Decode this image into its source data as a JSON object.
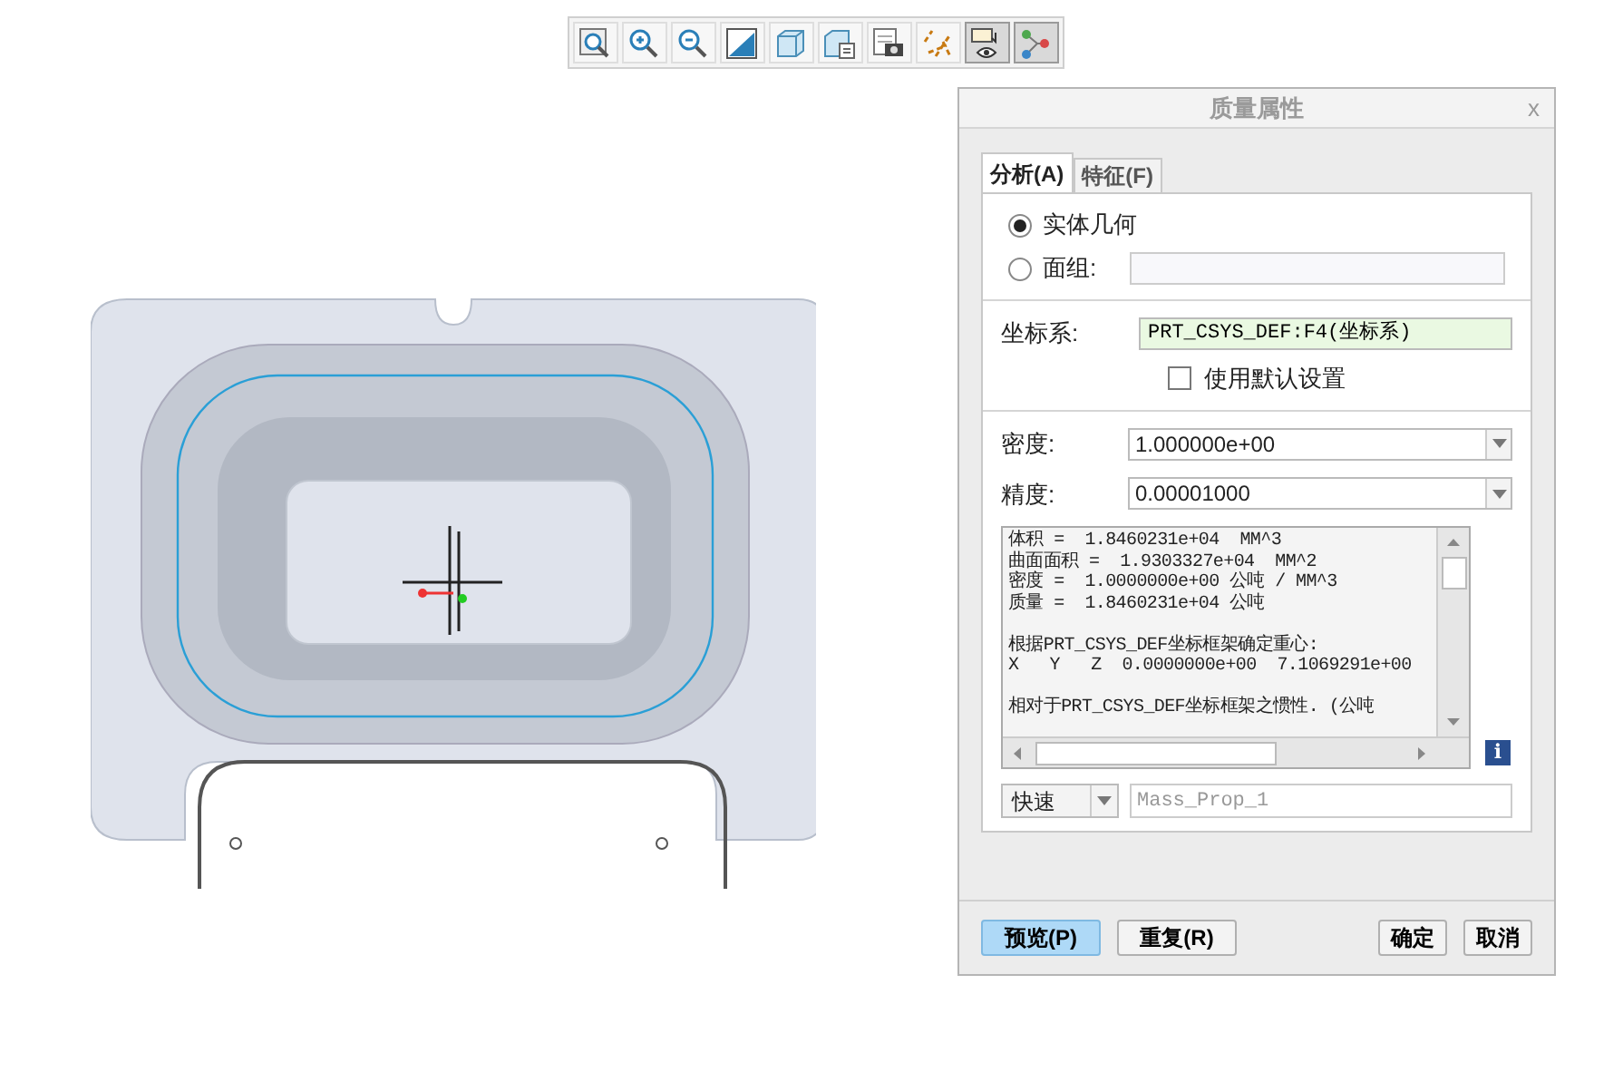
{
  "toolbar": [
    {
      "kind": "zoom-fit",
      "selected": false
    },
    {
      "kind": "zoom-in",
      "selected": false
    },
    {
      "kind": "zoom-out",
      "selected": false
    },
    {
      "kind": "repaint",
      "selected": false
    },
    {
      "kind": "view",
      "selected": false
    },
    {
      "kind": "views",
      "selected": false
    },
    {
      "kind": "camera",
      "selected": false
    },
    {
      "kind": "datum",
      "selected": false
    },
    {
      "kind": "display",
      "selected": true
    },
    {
      "kind": "nodes",
      "selected": true
    }
  ],
  "dialog": {
    "title": "质量属性",
    "close": "x",
    "tabs": [
      {
        "label": "分析(A)",
        "selected": true
      },
      {
        "label": "特征(F)",
        "selected": false
      }
    ],
    "radios": [
      {
        "label": "实体几何",
        "selected": true
      },
      {
        "label": "面组:",
        "selected": false,
        "field": true
      }
    ],
    "csys": {
      "label": "坐标系:",
      "value": "PRT_CSYS_DEF:F4(坐标系)"
    },
    "default_settings": {
      "label": "使用默认设置",
      "checked": false
    },
    "density": {
      "label": "密度:",
      "value": "1.000000e+00"
    },
    "accuracy": {
      "label": "精度:",
      "value": "0.00001000"
    },
    "results": [
      [
        "体积 =  1.8460231e+04  MM^3",
        "曲面面积 =  1.9303327e+04  MM^2",
        "密度 =  1.0000000e+00 公吨 / MM^3",
        "质量 =  1.8460231e+04 公吨"
      ],
      [
        "根据PRT_CSYS_DEF坐标框架确定重心:",
        "X   Y   Z  0.0000000e+00  7.1069291e+00"
      ],
      [
        "相对于PRT_CSYS_DEF坐标框架之惯性. (公吨"
      ]
    ],
    "info": "i",
    "mode": {
      "value": "快速"
    },
    "name": {
      "placeholder": "Mass_Prop_1"
    },
    "buttons": [
      {
        "label": "预览(P)",
        "kind": "primary"
      },
      {
        "label": "重复(R)",
        "kind": "normal"
      },
      {
        "label": "确定",
        "kind": "normal"
      },
      {
        "label": "取消",
        "kind": "normal"
      }
    ]
  }
}
